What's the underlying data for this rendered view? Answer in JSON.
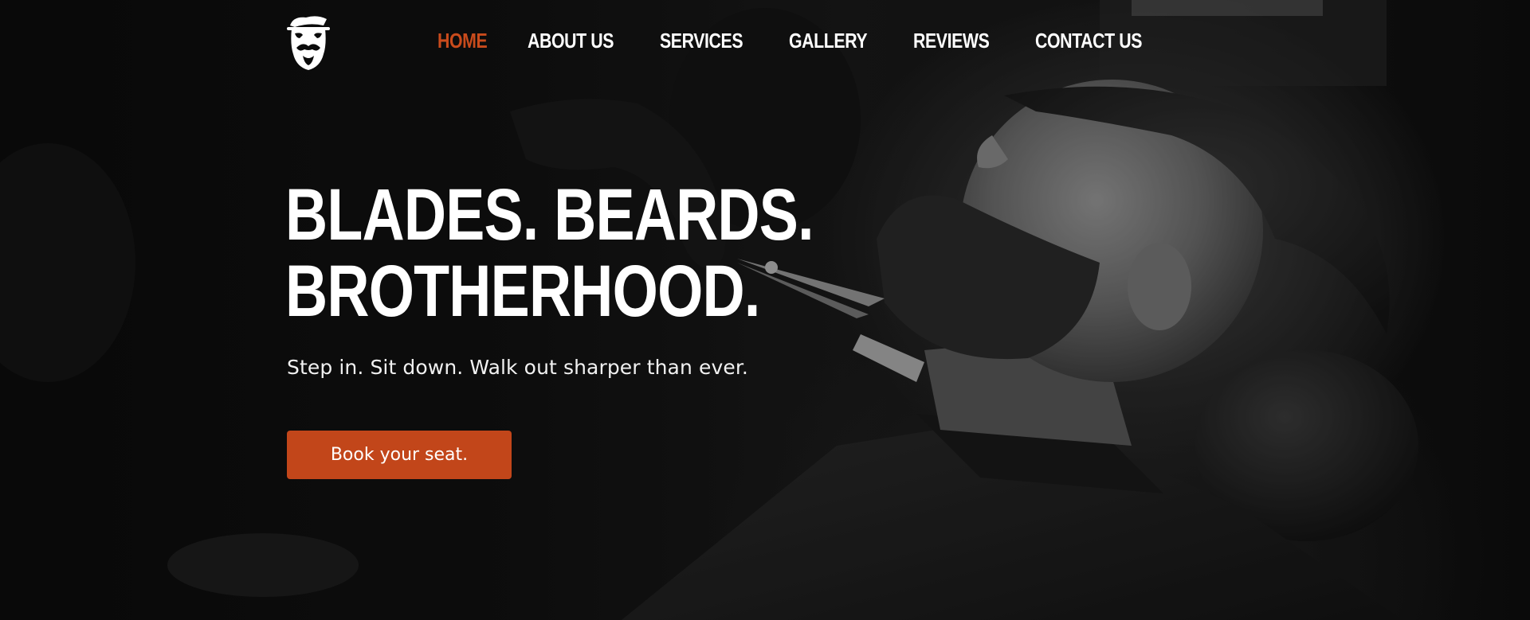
{
  "brand": {
    "logo_icon": "mustache-man-icon",
    "accent_color": "#c2461a",
    "active_nav_color": "#c94b1c"
  },
  "nav": {
    "items": [
      {
        "label": "HOME",
        "active": true
      },
      {
        "label": "ABOUT US",
        "active": false
      },
      {
        "label": "SERVICES",
        "active": false
      },
      {
        "label": "GALLERY",
        "active": false
      },
      {
        "label": "REVIEWS",
        "active": false
      },
      {
        "label": "CONTACT US",
        "active": false
      }
    ]
  },
  "hero": {
    "headline_line1": "BLADES. BEARDS.",
    "headline_line2": "BROTHERHOOD.",
    "tagline": "Step in. Sit down. Walk out sharper than ever.",
    "cta_label": "Book your seat."
  }
}
